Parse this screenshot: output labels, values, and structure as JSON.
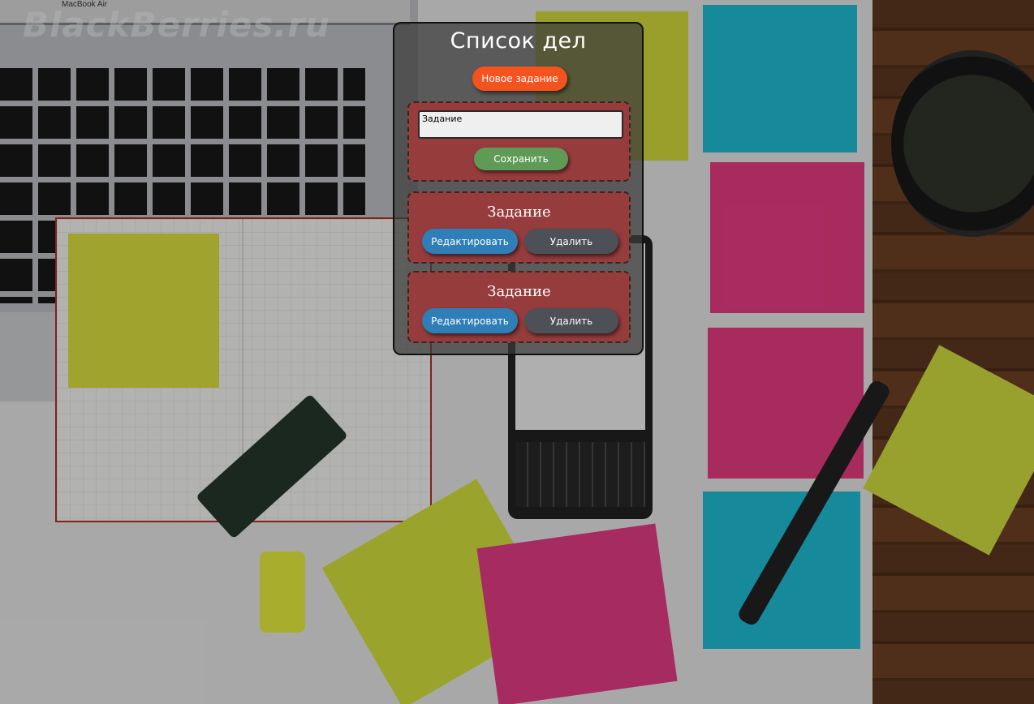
{
  "background": {
    "watermark": "BlackBerries.ru",
    "laptop_brand": "MacBook Air"
  },
  "todo": {
    "title": "Список дел",
    "new_task_label": "Новое задание",
    "form": {
      "input_value": "Задание",
      "save_label": "Сохранить"
    },
    "tasks": [
      {
        "title": "Задание",
        "edit_label": "Редактировать",
        "delete_label": "Удалить"
      },
      {
        "title": "Задание",
        "edit_label": "Редактировать",
        "delete_label": "Удалить"
      }
    ]
  },
  "colors": {
    "new_task_button": "#f5531d",
    "save_button": "#5f9b56",
    "edit_button": "#2e7eb8",
    "delete_button": "#4d5057",
    "card_background": "#973c3c"
  }
}
